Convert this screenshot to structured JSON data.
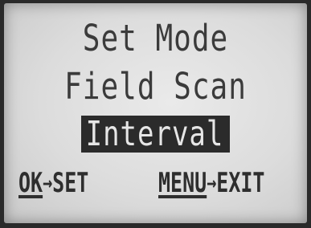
{
  "screen": {
    "title": "Set Mode",
    "subtitle": "Field Scan",
    "selected_option": "Interval"
  },
  "softkeys": {
    "ok": {
      "key": "OK",
      "arrow": "→",
      "action": "SET"
    },
    "menu": {
      "key": "MENU",
      "arrow": "→",
      "action": "EXIT"
    }
  },
  "colors": {
    "screen_bg": "#dcdcdc",
    "text": "#3b3b3b",
    "highlight_bg": "#2b2b2b",
    "highlight_text": "#e6e6e6"
  }
}
